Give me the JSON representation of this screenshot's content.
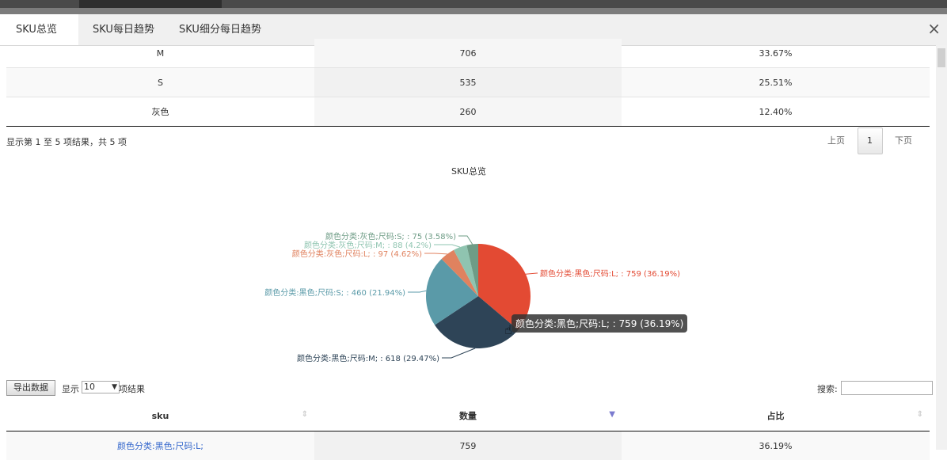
{
  "tabs": [
    {
      "label": "SKU总览",
      "active": true
    },
    {
      "label": "SKU每日趋势",
      "active": false
    },
    {
      "label": "SKU细分每日趋势",
      "active": false
    }
  ],
  "close_glyph": "×",
  "top_table": {
    "rows": [
      {
        "sku": "M",
        "count": "706",
        "ratio": "33.67%"
      },
      {
        "sku": "S",
        "count": "535",
        "ratio": "25.51%"
      },
      {
        "sku": "灰色",
        "count": "260",
        "ratio": "12.40%"
      }
    ]
  },
  "info_text": "显示第 1 至 5 项结果，共 5 项",
  "pagination": {
    "prev": "上页",
    "current": "1",
    "next": "下页"
  },
  "chart_title": "SKU总览",
  "chart_data": {
    "type": "pie",
    "title": "SKU总览",
    "slices": [
      {
        "label": "颜色分类:黑色;尺码:L; : 759 (36.19%)",
        "name": "颜色分类:黑色;尺码:L;",
        "value": 759,
        "percent": 36.19,
        "color": "#e34a33"
      },
      {
        "label": "颜色分类:黑色;尺码:M; : 618 (29.47%)",
        "name": "颜色分类:黑色;尺码:M;",
        "value": 618,
        "percent": 29.47,
        "color": "#2e4457"
      },
      {
        "label": "颜色分类:黑色;尺码:S; : 460 (21.94%)",
        "name": "颜色分类:黑色;尺码:S;",
        "value": 460,
        "percent": 21.94,
        "color": "#5a9aa8"
      },
      {
        "label": "颜色分类:灰色;尺码:L; : 97 (4.62%)",
        "name": "颜色分类:灰色;尺码:L;",
        "value": 97,
        "percent": 4.62,
        "color": "#e0825f"
      },
      {
        "label": "颜色分类:灰色;尺码:M; : 88 (4.2%)",
        "name": "颜色分类:灰色;尺码:M;",
        "value": 88,
        "percent": 4.2,
        "color": "#8fc4b0"
      },
      {
        "label": "颜色分类:灰色;尺码:S; : 75 (3.58%)",
        "name": "颜色分类:灰色;尺码:S;",
        "value": 75,
        "percent": 3.58,
        "color": "#6e9c86"
      }
    ]
  },
  "tooltip": "颜色分类:黑色;尺码:L; : 759 (36.19%)",
  "controls": {
    "export_label": "导出数据",
    "length_prefix": "显示",
    "length_value": "10",
    "length_suffix": "项结果",
    "search_label": "搜索:",
    "search_value": ""
  },
  "bottom_table": {
    "headers": {
      "sku": "sku",
      "count": "数量",
      "ratio": "占比"
    },
    "rows": [
      {
        "sku": "颜色分类:黑色;尺码:L;",
        "count": "759",
        "ratio": "36.19%"
      }
    ]
  }
}
